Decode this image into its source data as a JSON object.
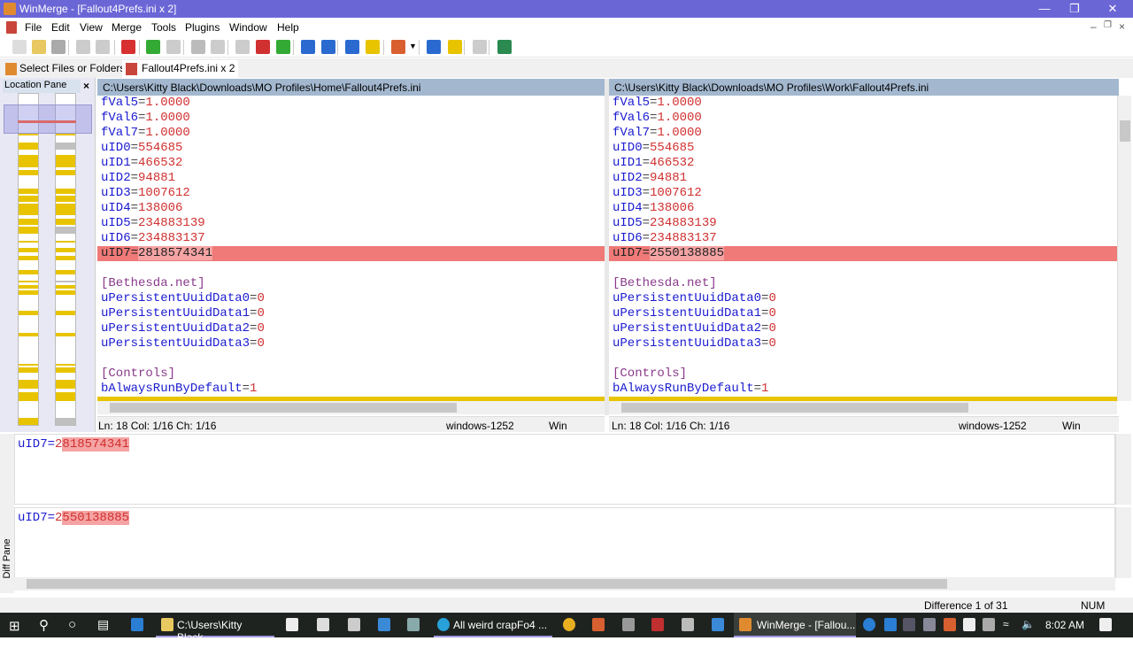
{
  "window": {
    "title": "WinMerge - [Fallout4Prefs.ini x 2]",
    "accent": "#6b66d6"
  },
  "menu": [
    "File",
    "Edit",
    "View",
    "Merge",
    "Tools",
    "Plugins",
    "Window",
    "Help"
  ],
  "tabs": [
    {
      "label": "Select Files or Folders"
    },
    {
      "label": "Fallout4Prefs.ini x 2"
    }
  ],
  "location_pane": {
    "title": "Location Pane"
  },
  "left": {
    "path": "C:\\Users\\Kitty Black\\Downloads\\MO Profiles\\Home\\Fallout4Prefs.ini",
    "status": {
      "pos": "Ln: 18  Col: 1/16  Ch: 1/16",
      "encoding": "windows-1252",
      "eol": "Win"
    },
    "lines": [
      [
        "fVal5",
        "1.0000"
      ],
      [
        "fVal6",
        "1.0000"
      ],
      [
        "fVal7",
        "1.0000"
      ],
      [
        "uID0",
        "554685"
      ],
      [
        "uID1",
        "466532"
      ],
      [
        "uID2",
        "94881"
      ],
      [
        "uID3",
        "1007612"
      ],
      [
        "uID4",
        "138006"
      ],
      [
        "uID5",
        "234883139"
      ],
      [
        "uID6",
        "234883137"
      ],
      [
        "uID7",
        "2818574341",
        "diff"
      ],
      [
        "",
        ""
      ],
      [
        "[Bethesda.net]",
        "",
        "section"
      ],
      [
        "uPersistentUuidData0",
        "0"
      ],
      [
        "uPersistentUuidData1",
        "0"
      ],
      [
        "uPersistentUuidData2",
        "0"
      ],
      [
        "uPersistentUuidData3",
        "0"
      ],
      [
        "",
        ""
      ],
      [
        "[Controls]",
        "",
        "section"
      ],
      [
        "bAlwaysRunByDefault",
        "1"
      ]
    ]
  },
  "right": {
    "path": "C:\\Users\\Kitty Black\\Downloads\\MO Profiles\\Work\\Fallout4Prefs.ini",
    "status": {
      "pos": "Ln: 18  Col: 1/16  Ch: 1/16",
      "encoding": "windows-1252",
      "eol": "Win"
    },
    "lines": [
      [
        "fVal5",
        "1.0000"
      ],
      [
        "fVal6",
        "1.0000"
      ],
      [
        "fVal7",
        "1.0000"
      ],
      [
        "uID0",
        "554685"
      ],
      [
        "uID1",
        "466532"
      ],
      [
        "uID2",
        "94881"
      ],
      [
        "uID3",
        "1007612"
      ],
      [
        "uID4",
        "138006"
      ],
      [
        "uID5",
        "234883139"
      ],
      [
        "uID6",
        "234883137"
      ],
      [
        "uID7",
        "2550138885",
        "diff"
      ],
      [
        "",
        ""
      ],
      [
        "[Bethesda.net]",
        "",
        "section"
      ],
      [
        "uPersistentUuidData0",
        "0"
      ],
      [
        "uPersistentUuidData1",
        "0"
      ],
      [
        "uPersistentUuidData2",
        "0"
      ],
      [
        "uPersistentUuidData3",
        "0"
      ],
      [
        "",
        ""
      ],
      [
        "[Controls]",
        "",
        "section"
      ],
      [
        "bAlwaysRunByDefault",
        "1"
      ]
    ]
  },
  "diff_pane": {
    "label": "Diff Pane",
    "top": {
      "key": "uID7=",
      "same": "2",
      "changed": "818574341"
    },
    "bottom": {
      "key": "uID7=",
      "same": "2",
      "changed": "550138885"
    }
  },
  "status": {
    "difference": "Difference 1 of 31",
    "num": "NUM"
  },
  "taskbar": {
    "items": [
      "C:\\Users\\Kitty Black...",
      "All weird crapFo4 ...",
      "WinMerge - [Fallou..."
    ],
    "clock": "8:02 AM"
  },
  "colors": {
    "diff_line": "#ef7a78",
    "diff_word": "#f5a3a3",
    "moved": "#e8c400"
  }
}
